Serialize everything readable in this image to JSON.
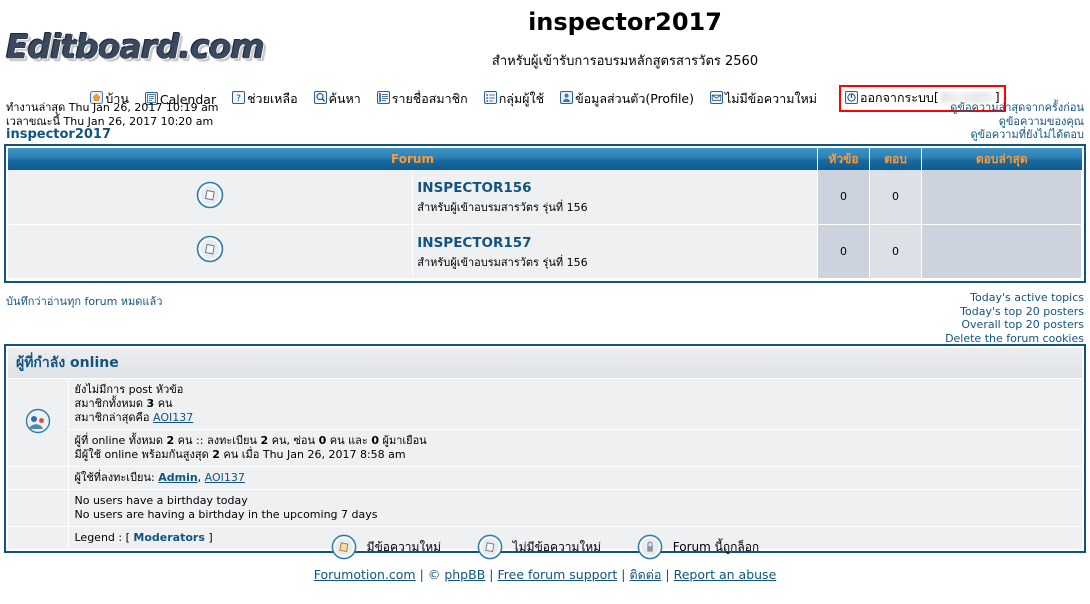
{
  "header": {
    "logo_text": "Editboard.com",
    "site_title": "inspector2017",
    "site_description": "สำหรับผู้เข้ารับการอบรมหลักสูตรสารวัตร 2560"
  },
  "nav": {
    "items": [
      {
        "label": "บ้าน",
        "icon": "home-icon"
      },
      {
        "label": "Calendar",
        "icon": "calendar-icon"
      },
      {
        "label": "ช่วยเหลือ",
        "icon": "help-icon"
      },
      {
        "label": "ค้นหา",
        "icon": "search-icon"
      },
      {
        "label": "รายชื่อสมาชิก",
        "icon": "memberlist-icon"
      },
      {
        "label": "กลุ่มผู้ใช้",
        "icon": "usergroups-icon"
      },
      {
        "label": "ข้อมูลส่วนตัว(Profile)",
        "icon": "profile-icon"
      },
      {
        "label": "ไม่มีข้อความใหม่",
        "icon": "no-new-message-icon"
      }
    ],
    "logout": {
      "label": "ออกจากระบบ",
      "bracket_open": "[",
      "bracket_close": "]",
      "username": "",
      "icon": "logout-icon",
      "highlight_color": "#ff0000"
    }
  },
  "info": {
    "last_visit_label": "ทำงานล่าสุด",
    "last_visit_time": "Thu Jan 26, 2017 10:19 am",
    "current_time_label": "เวลาขณะนี้",
    "current_time": "Thu Jan 26, 2017 10:20 am",
    "current_user": "inspector2017",
    "quick_links": [
      "ดูข้อความล่าสุดจากครั้งก่อน",
      "ดูข้อความของคุณ",
      "ดูข้อความที่ยังไม่ได้ตอบ"
    ]
  },
  "forum_table": {
    "columns": [
      "Forum",
      "หัวข้อ",
      "ตอบ",
      "ตอบล่าสุด"
    ],
    "header_text_color": "#ff9933",
    "rows": [
      {
        "icon": "folder-no-new-posts-icon",
        "name": "INSPECTOR156",
        "description": "สำหรับผู้เข้าอบรมสารวัตร รุ่นที่ 156",
        "topics": "0",
        "replies": "0",
        "last_post": ""
      },
      {
        "icon": "folder-no-new-posts-icon",
        "name": "INSPECTOR157",
        "description": "สำหรับผู้เข้าอบรมสารวัตร รุ่นที่ 156",
        "topics": "0",
        "replies": "0",
        "last_post": ""
      }
    ]
  },
  "mid": {
    "mark_read": "บันทึกว่าอ่านทุก forum หมดแล้ว",
    "right_links": [
      "Today's active topics",
      "Today's top 20 posters",
      "Overall top 20 posters",
      "Delete the forum cookies"
    ]
  },
  "online_panel": {
    "title": "ผู้ที่กำลัง online",
    "icon": "who-is-online-icon",
    "stats_no_posts": "ยังไม่มีการ post หัวข้อ",
    "stats_total_members_pre": "สมาชิกทั้งหมด",
    "stats_total_members_count": "3",
    "stats_total_members_post": "คน",
    "stats_newest_label": "สมาชิกล่าสุดคือ",
    "stats_newest_member": "AOI137",
    "online_line_1_a": "ผู้ที่ online ทั้งหมด",
    "online_line_1_count": "2",
    "online_line_1_b": "คน :: ลงทะเบียน",
    "online_line_1_registered": "2",
    "online_line_1_c": "คน, ซ่อน",
    "online_line_1_hidden": "0",
    "online_line_1_d": "คน และ",
    "online_line_1_guests": "0",
    "online_line_1_e": "ผู้มาเยือน",
    "online_line_2_a": "มีผู้ใช้ online พร้อมกันสูงสุด",
    "online_line_2_count": "2",
    "online_line_2_b": "คน เมื่อ Thu Jan 26, 2017 8:58 am",
    "registered_label": "ผู้ใช้ที่ลงทะเบียน:",
    "registered_users": [
      "Admin",
      "AOI137"
    ],
    "birthday_today": "No users have a birthday today",
    "birthday_upcoming": "No users are having a birthday in the upcoming 7 days",
    "legend_label": "Legend :",
    "legend_open": "[",
    "legend_group": "Moderators",
    "legend_close": "]"
  },
  "footer": {
    "legend": [
      {
        "icon": "folder-new-posts-icon",
        "label": "มีข้อความใหม่"
      },
      {
        "icon": "folder-no-new-posts-icon",
        "label": "ไม่มีข้อความใหม่"
      },
      {
        "icon": "folder-locked-icon",
        "label": "Forum นี้ถูกล็อก"
      }
    ],
    "links": [
      "Forumotion.com",
      "phpBB",
      "Free forum support",
      "ติดต่อ",
      "Report an abuse"
    ],
    "copyright_symbol": "©",
    "separator": "|"
  }
}
